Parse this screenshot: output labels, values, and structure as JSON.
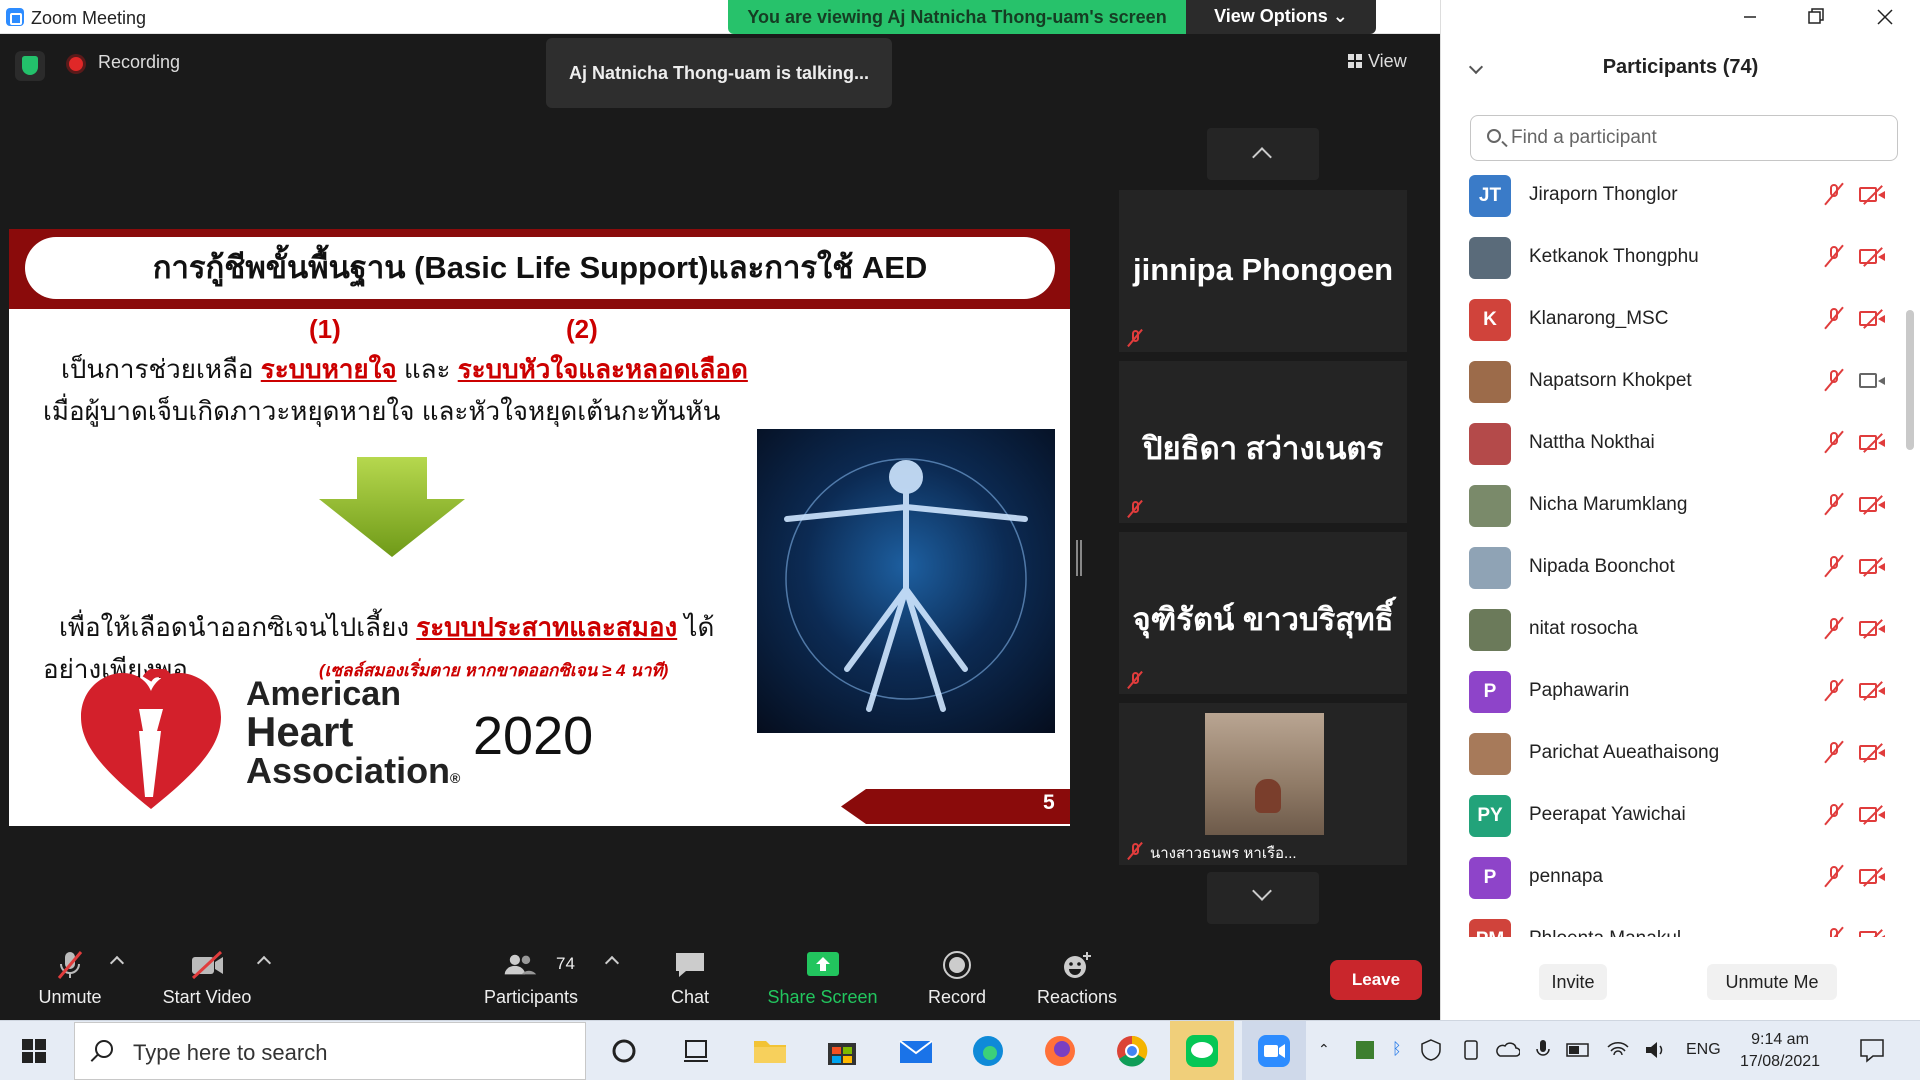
{
  "window": {
    "title": "Zoom Meeting"
  },
  "banner": {
    "viewing": "You are viewing Aj Natnicha Thong-uam's screen",
    "view_options": "View Options ⌄"
  },
  "meeting": {
    "recording": "Recording",
    "talking": "Aj Natnicha Thong-uam is talking...",
    "view": "View"
  },
  "slide": {
    "title": "การกู้ชีพขั้นพื้นฐาน (Basic Life Support)และการใช้ AED",
    "marker1": "(1)",
    "marker2": "(2)",
    "line1_a": "เป็นการช่วยเหลือ ",
    "line1_b": "ระบบหายใจ",
    "line1_c": " และ ",
    "line1_d": "ระบบหัวใจและหลอดเลือด",
    "line2": "เมื่อผู้บาดเจ็บเกิดภาวะหยุดหายใจ และหัวใจหยุดเต้นกะทันหัน",
    "line3_a": "เพื่อให้เลือดนำออกซิเจนไปเลี้ยง ",
    "line3_b": "ระบบประสาทและสมอง",
    "line3_c": " ได้",
    "line4": "อย่างเพียงพอ",
    "note": "(เซลล์สมองเริ่มตาย หากขาดออกซิเจน ≥ 4 นาที)",
    "logo_line1": "American",
    "logo_line2": "Heart",
    "logo_line3": "Association",
    "logo_mark": "®",
    "year": "2020",
    "page": "5"
  },
  "tiles": [
    {
      "name": "jinnipa Phongoen"
    },
    {
      "name": "ปิยธิดา สว่างเนตร"
    },
    {
      "name": "จุฑิรัตน์ ขาวบริสุทธิ์"
    },
    {
      "name": "นางสาวธนพร หาเรือ..."
    }
  ],
  "toolbar": {
    "unmute": "Unmute",
    "start_video": "Start Video",
    "participants": "Participants",
    "participants_count": "74",
    "chat": "Chat",
    "share_screen": "Share Screen",
    "record": "Record",
    "reactions": "Reactions",
    "leave": "Leave"
  },
  "panel": {
    "title": "Participants (74)",
    "search_placeholder": "Find a participant",
    "invite": "Invite",
    "unmute_me": "Unmute Me",
    "participants": [
      {
        "initials": "JT",
        "name": "Jiraporn Thonglor",
        "color": "#3a7bc8",
        "video": "off"
      },
      {
        "initials": "",
        "name": "Ketkanok Thongphu",
        "color": "#5a6b7a",
        "video": "off"
      },
      {
        "initials": "K",
        "name": "Klanarong_MSC",
        "color": "#d0433b",
        "video": "off"
      },
      {
        "initials": "",
        "name": "Napatsorn Khokpet",
        "color": "#9c6b4a",
        "video": "on"
      },
      {
        "initials": "",
        "name": "Nattha Nokthai",
        "color": "#b44a4a",
        "video": "off"
      },
      {
        "initials": "",
        "name": "Nicha Marumklang",
        "color": "#7a8a6a",
        "video": "off"
      },
      {
        "initials": "",
        "name": "Nipada Boonchot",
        "color": "#8fa3b5",
        "video": "off"
      },
      {
        "initials": "",
        "name": "nitat rosocha",
        "color": "#6b7a5a",
        "video": "off"
      },
      {
        "initials": "P",
        "name": "Paphawarin",
        "color": "#8e44c9",
        "video": "off"
      },
      {
        "initials": "",
        "name": "Parichat Aueathaisong",
        "color": "#a77a5a",
        "video": "off"
      },
      {
        "initials": "PY",
        "name": "Peerapat Yawichai",
        "color": "#22a37a",
        "video": "off"
      },
      {
        "initials": "P",
        "name": "pennapa",
        "color": "#8e44c9",
        "video": "off"
      },
      {
        "initials": "PM",
        "name": "Phloenta Manakul",
        "color": "#d0433b",
        "video": "off"
      }
    ]
  },
  "taskbar": {
    "search_placeholder": "Type here to search",
    "lang": "ENG",
    "time": "9:14 am",
    "date": "17/08/2021"
  }
}
